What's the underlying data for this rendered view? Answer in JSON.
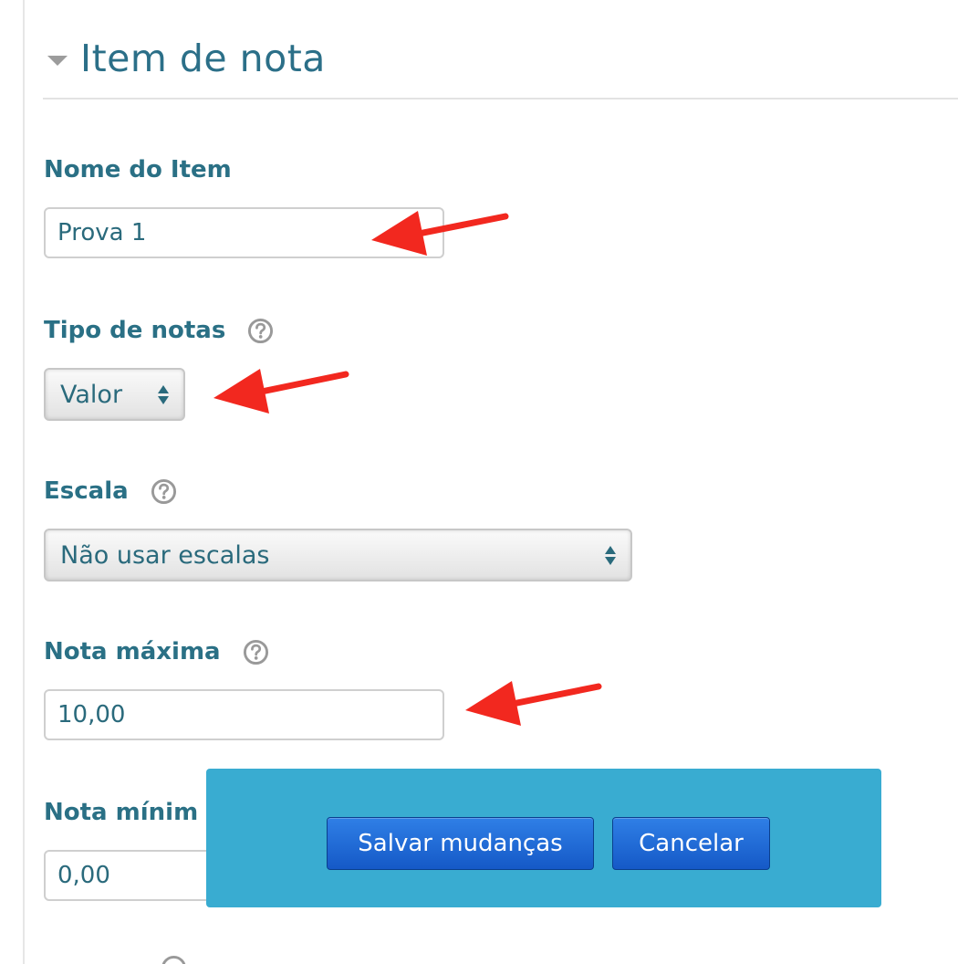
{
  "section": {
    "title": "Item de nota"
  },
  "fields": {
    "item_name": {
      "label": "Nome do Item",
      "value": "Prova 1"
    },
    "grade_type": {
      "label": "Tipo de notas",
      "value": "Valor"
    },
    "scale": {
      "label": "Escala",
      "value": "Não usar escalas"
    },
    "max_grade": {
      "label": "Nota máxima",
      "value": "10,00"
    },
    "min_grade": {
      "label": "Nota mínim",
      "value": "0,00"
    }
  },
  "footer": {
    "save_label": "Salvar mudanças",
    "cancel_label": "Cancelar"
  },
  "colors": {
    "heading": "#2b6f88",
    "label": "#2a7085",
    "annotation_arrow": "#f2281f",
    "footer_bar": "#39acd1",
    "button": "#1f66d6"
  },
  "icons": {
    "collapse": "caret-down-icon",
    "help": "help-icon",
    "select": "select-updown-icon",
    "annotation": "red-arrow-icon"
  }
}
